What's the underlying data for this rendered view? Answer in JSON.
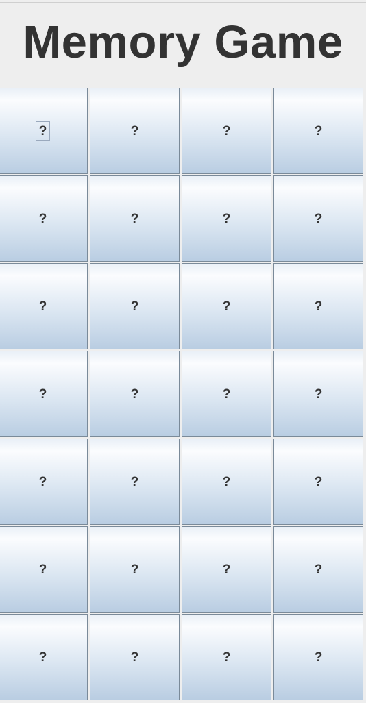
{
  "header": {
    "title": "Memory Game"
  },
  "board": {
    "rows": 7,
    "columns": 4,
    "focused_card": 0,
    "cards": [
      {
        "label": "?"
      },
      {
        "label": "?"
      },
      {
        "label": "?"
      },
      {
        "label": "?"
      },
      {
        "label": "?"
      },
      {
        "label": "?"
      },
      {
        "label": "?"
      },
      {
        "label": "?"
      },
      {
        "label": "?"
      },
      {
        "label": "?"
      },
      {
        "label": "?"
      },
      {
        "label": "?"
      },
      {
        "label": "?"
      },
      {
        "label": "?"
      },
      {
        "label": "?"
      },
      {
        "label": "?"
      },
      {
        "label": "?"
      },
      {
        "label": "?"
      },
      {
        "label": "?"
      },
      {
        "label": "?"
      },
      {
        "label": "?"
      },
      {
        "label": "?"
      },
      {
        "label": "?"
      },
      {
        "label": "?"
      },
      {
        "label": "?"
      },
      {
        "label": "?"
      },
      {
        "label": "?"
      },
      {
        "label": "?"
      }
    ]
  }
}
